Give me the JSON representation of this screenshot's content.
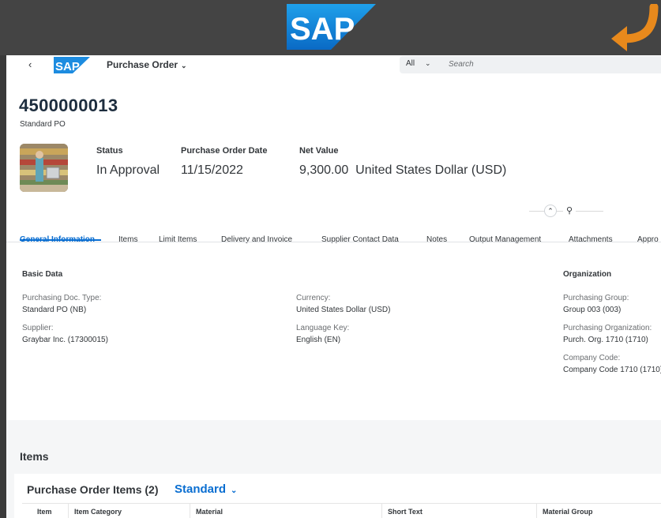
{
  "banner": {
    "logo_text": "SAP",
    "back_icon": "curved-arrow-icon"
  },
  "shell": {
    "back_icon": "chevron-left-icon",
    "back_glyph": "‹",
    "logo_text": "SAP",
    "title": "Purchase Order",
    "title_chevron": "⌄",
    "search_scope": "All",
    "search_scope_chevron": "⌄",
    "search_placeholder": "Search"
  },
  "header": {
    "po_number": "4500000013",
    "po_type": "Standard PO",
    "attributes": [
      {
        "label": "Status",
        "value": "In Approval"
      },
      {
        "label": "Purchase Order Date",
        "value": "11/15/2022"
      },
      {
        "label": "Net Value",
        "value": "9,300.00  United States Dollar (USD)"
      }
    ],
    "collapse_glyph": "⌃",
    "pin_glyph": "⚲"
  },
  "tabs": [
    "General Information",
    "Items",
    "Limit Items",
    "Delivery and Invoice",
    "Supplier Contact Data",
    "Notes",
    "Output Management",
    "Attachments",
    "Appro"
  ],
  "general": {
    "basic_data": {
      "title": "Basic Data",
      "fields": [
        {
          "label": "Purchasing Doc. Type:",
          "value": "Standard PO (NB)"
        },
        {
          "label": "Supplier:",
          "value": "Graybar Inc. (17300015)"
        },
        {
          "label": "Currency:",
          "value": "United States Dollar (USD)"
        },
        {
          "label": "Language Key:",
          "value": "English (EN)"
        }
      ]
    },
    "organization": {
      "title": "Organization",
      "fields": [
        {
          "label": "Purchasing Group:",
          "value": "Group 003 (003)"
        },
        {
          "label": "Purchasing Organization:",
          "value": "Purch. Org. 1710 (1710)"
        },
        {
          "label": "Company Code:",
          "value": "Company Code 1710 (1710)"
        }
      ]
    }
  },
  "items": {
    "section_title": "Items",
    "table_title": "Purchase Order Items (2)",
    "variant": "Standard",
    "variant_chevron": "⌄",
    "columns": [
      "Item",
      "Item Category",
      "Material",
      "Short Text",
      "Material Group"
    ]
  },
  "colors": {
    "brand_blue": "#0a6ed1",
    "sap_blue": "#1d8ce0",
    "banner_gray": "#444444",
    "arrow_orange": "#e8891c"
  }
}
